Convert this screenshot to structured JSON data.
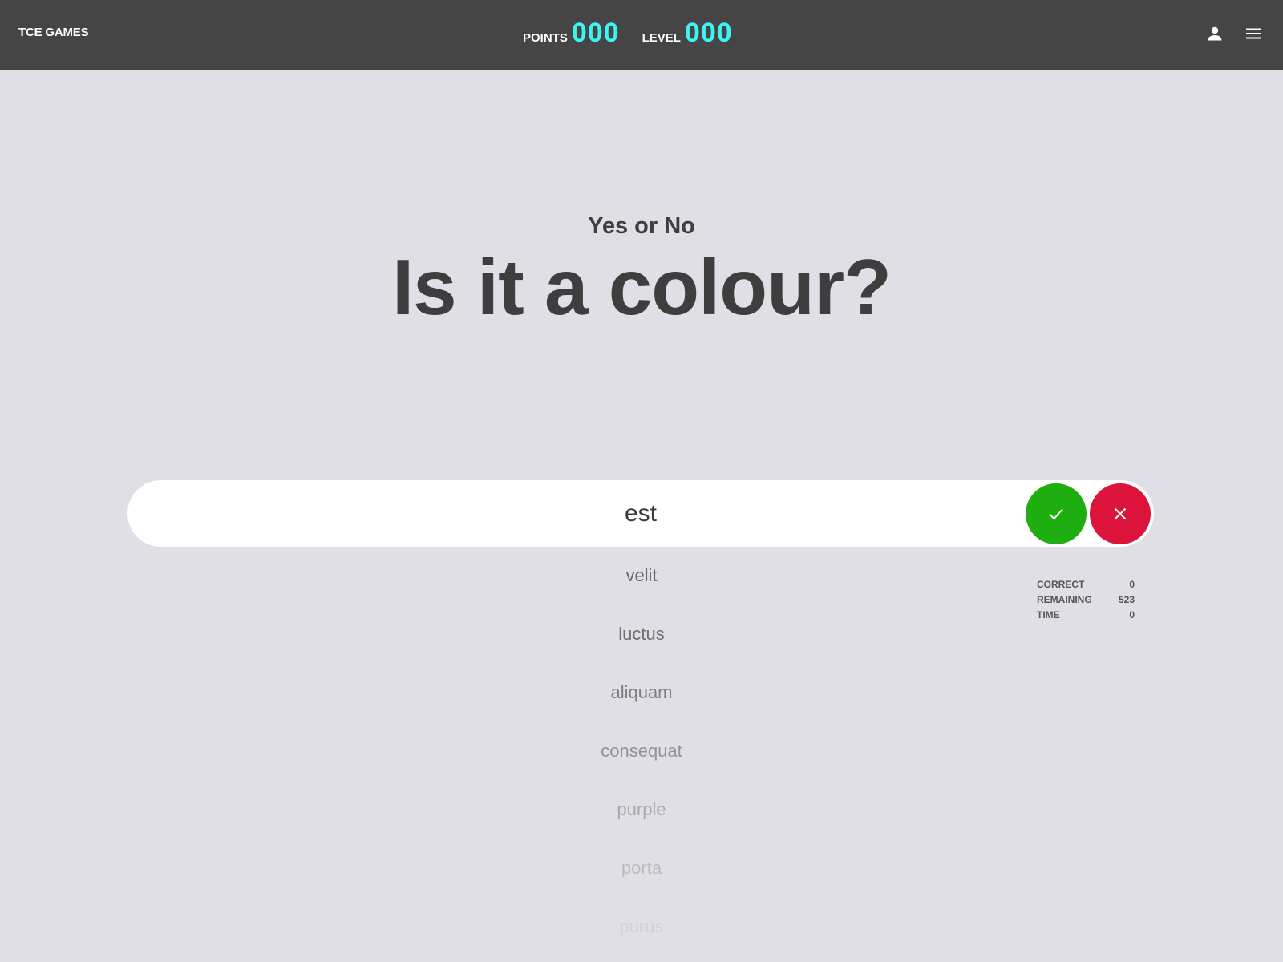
{
  "header": {
    "brand": "TCE GAMES",
    "points_label": "POINTS",
    "points_value": "000",
    "level_label": "LEVEL",
    "level_value": "000",
    "icons": [
      "person-icon",
      "menu-icon"
    ]
  },
  "game": {
    "subtitle": "Yes or No",
    "question": "Is it a colour?",
    "current_word": "est",
    "upcoming_words": [
      "velit",
      "luctus",
      "aliquam",
      "consequat",
      "purple",
      "porta",
      "purus"
    ]
  },
  "stats": {
    "correct_label": "CORRECT",
    "correct_value": "0",
    "remaining_label": "REMAINING",
    "remaining_value": "523",
    "time_label": "TIME",
    "time_value": "0"
  },
  "colors": {
    "topbar": "#454545",
    "score_accent": "#3ff2f2",
    "yes_button": "#1fae10",
    "no_button": "#dc143c",
    "background": "#e0dfe5"
  }
}
